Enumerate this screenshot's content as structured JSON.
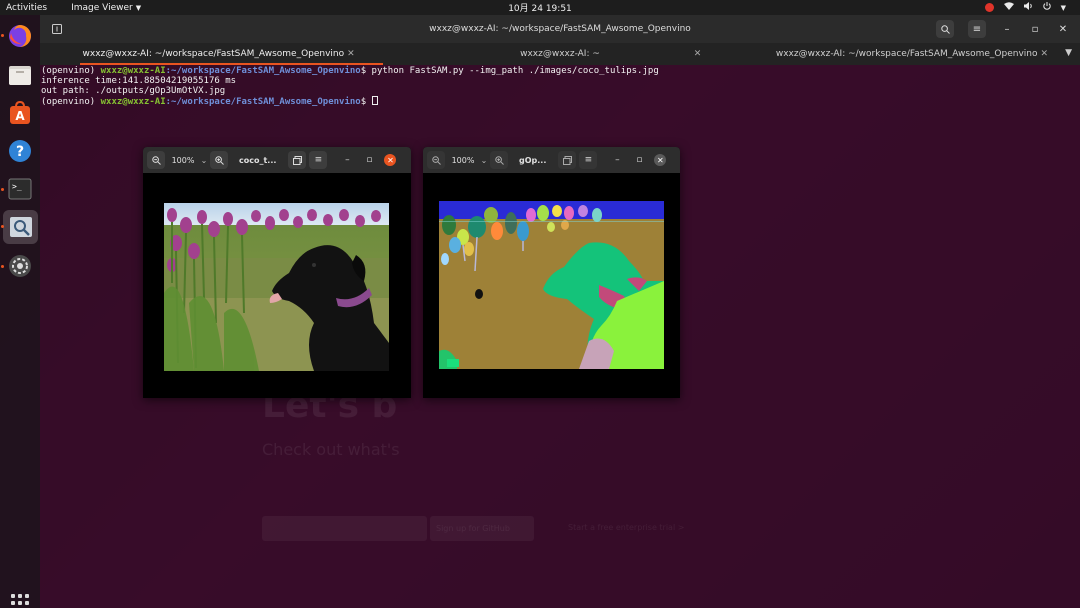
{
  "topbar": {
    "activities": "Activities",
    "app_menu": "Image Viewer",
    "clock": "10月 24  19:51"
  },
  "dock": {
    "items": [
      "firefox-icon",
      "files-icon",
      "software-icon",
      "help-icon",
      "terminal-icon",
      "image-viewer-icon",
      "settings-icon"
    ]
  },
  "terminal": {
    "title": "wxxz@wxxz-AI: ~/workspace/FastSAM_Awsome_Openvino",
    "tabs": [
      "wxxz@wxxz-AI: ~/workspace/FastSAM_Awsome_Openvino",
      "wxxz@wxxz-AI: ~",
      "wxxz@wxxz-AI: ~/workspace/FastSAM_Awsome_Openvino"
    ],
    "lines": {
      "env": "(openvino) ",
      "userhost": "wxxz@wxxz-AI",
      "path": ":~/workspace/FastSAM_Awsome_Openvino",
      "command": "$ python FastSAM.py --img_path ./images/coco_tulips.jpg",
      "inference": "inference time:141.88504219055176 ms",
      "outpath": "out path: ./outputs/gOp3UmOtVX.jpg",
      "prompt_end": "$ "
    }
  },
  "viewer_left": {
    "zoom": "100%",
    "title": "coco_t..."
  },
  "viewer_right": {
    "zoom": "100%",
    "title": "gOp..."
  },
  "background_page": {
    "heading": "Let's b",
    "subline": "Check out what's",
    "button": "Sign up for GitHub",
    "link": "Start a free enterprise trial >"
  },
  "colors": {
    "accent": "#e95420",
    "userhost": "#86c232",
    "path": "#6f8fd8"
  }
}
